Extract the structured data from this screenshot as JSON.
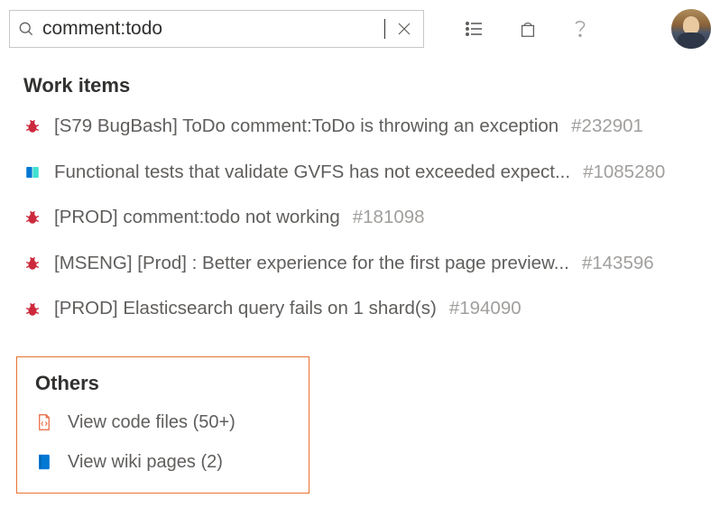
{
  "search": {
    "value": "comment:todo",
    "placeholder": ""
  },
  "sections": {
    "work_items": {
      "title": "Work items",
      "items": [
        {
          "icon": "bug",
          "title": "[S79 BugBash] ToDo comment:ToDo is throwing an exception",
          "id": "#232901"
        },
        {
          "icon": "book",
          "title": "Functional tests that validate GVFS has not exceeded expect...",
          "id": "#1085280"
        },
        {
          "icon": "bug",
          "title": "[PROD] comment:todo not working",
          "id": "#181098"
        },
        {
          "icon": "bug",
          "title": "[MSENG] [Prod] : Better experience for the first page preview...",
          "id": "#143596"
        },
        {
          "icon": "bug",
          "title": "[PROD] Elasticsearch query fails on 1 shard(s)",
          "id": "#194090"
        }
      ]
    },
    "others": {
      "title": "Others",
      "items": [
        {
          "icon": "code",
          "label": "View code files (50+)"
        },
        {
          "icon": "wiki",
          "label": "View wiki pages (2)"
        }
      ]
    }
  }
}
